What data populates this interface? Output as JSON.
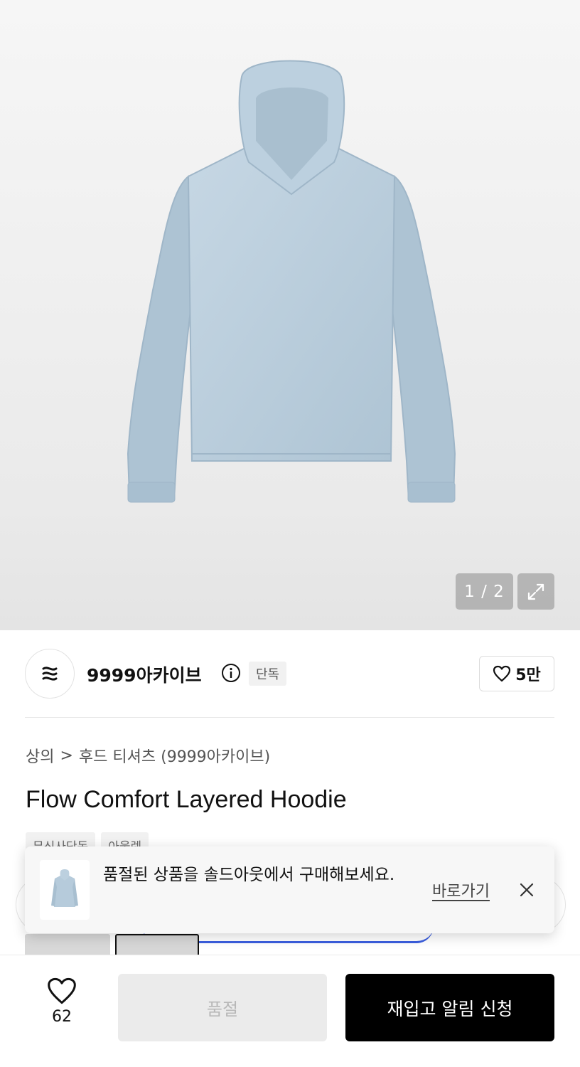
{
  "image_viewer": {
    "counter": "1 / 2",
    "expand_icon": "expand-arrows-icon"
  },
  "brand": {
    "name": "9999아카이브",
    "logo_icon": "brand-logo-icon",
    "exclusive_badge": "단독",
    "likes": "5만"
  },
  "breadcrumb": {
    "category": "상의",
    "separator": ">",
    "subcategory": "후드 티셔츠 (9999아카이브)"
  },
  "product": {
    "title": "Flow Comfort Layered Hoodie",
    "tags": [
      "무신사단독",
      "아울렛"
    ]
  },
  "toast": {
    "message": "품절된 상품을 솔드아웃에서 구매해보세요.",
    "link_label": "바로가기"
  },
  "bottom_bar": {
    "wish_count": "62",
    "soldout_label": "품절",
    "restock_label": "재입고 알림 신청"
  },
  "colors": {
    "hoodie": "#b9cedd",
    "cta_black": "#000000",
    "accent_blue": "#3b5ede"
  }
}
